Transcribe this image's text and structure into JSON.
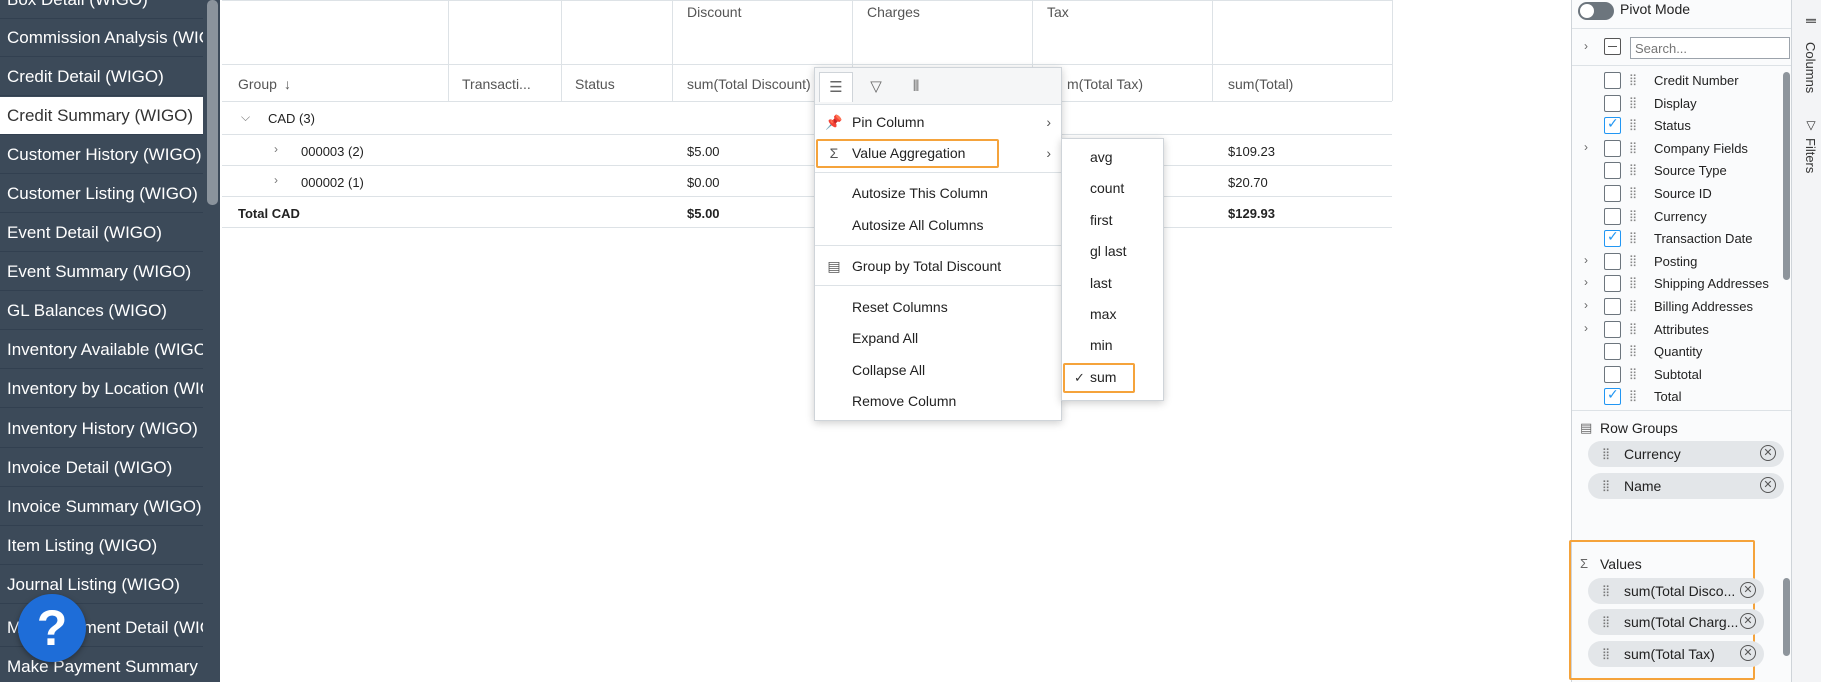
{
  "sidebar": {
    "items": [
      {
        "label": "Box Detail (WIGO)",
        "active": false
      },
      {
        "label": "Commission Analysis (WIGO)",
        "active": false
      },
      {
        "label": "Credit Detail (WIGO)",
        "active": false
      },
      {
        "label": "Credit Summary (WIGO)",
        "active": true
      },
      {
        "label": "Customer History (WIGO)",
        "active": false
      },
      {
        "label": "Customer Listing (WIGO)",
        "active": false
      },
      {
        "label": "Event Detail (WIGO)",
        "active": false
      },
      {
        "label": "Event Summary (WIGO)",
        "active": false
      },
      {
        "label": "GL Balances (WIGO)",
        "active": false
      },
      {
        "label": "Inventory Available (WIGO)",
        "active": false
      },
      {
        "label": "Inventory by Location (WIGO)",
        "active": false
      },
      {
        "label": "Inventory History (WIGO)",
        "active": false
      },
      {
        "label": "Invoice Detail (WIGO)",
        "active": false
      },
      {
        "label": "Invoice Summary (WIGO)",
        "active": false
      },
      {
        "label": "Item Listing (WIGO)",
        "active": false
      },
      {
        "label": "Journal Listing (WIGO)",
        "active": false
      },
      {
        "label": "Make Payment Detail (WIGO)",
        "active": false
      },
      {
        "label": "Make Payment Summary (WIGO)",
        "active": false
      }
    ],
    "help_glyph": "?"
  },
  "grid": {
    "group_headers": [
      "Discount",
      "Charges",
      "Tax"
    ],
    "columns": [
      "Group",
      "Transacti...",
      "Status",
      "sum(Total Discount)",
      "sum(Total Charges)",
      "sum(Total Tax)",
      "sum(Total)"
    ],
    "sort_glyph": "↓",
    "visible_header_fragment": "m(Total Tax)",
    "rows": [
      {
        "label": "CAD (3)",
        "discount": "",
        "total": ""
      },
      {
        "label": "000003 (2)",
        "discount": "$5.00",
        "total": "$109.23"
      },
      {
        "label": "000002 (1)",
        "discount": "$0.00",
        "total": "$20.70"
      },
      {
        "label": "Total CAD",
        "discount": "$5.00",
        "total": "$129.93"
      }
    ]
  },
  "column_menu": {
    "tabs": [
      "general-menu",
      "filter",
      "columns"
    ],
    "items": {
      "pin_column": "Pin Column",
      "value_aggregation": "Value Aggregation",
      "autosize_this": "Autosize This Column",
      "autosize_all": "Autosize All Columns",
      "group_by": "Group by Total Discount",
      "reset_columns": "Reset Columns",
      "expand_all": "Expand All",
      "collapse_all": "Collapse All",
      "remove_column": "Remove Column"
    }
  },
  "aggregation_menu": {
    "options": [
      "avg",
      "count",
      "first",
      "gl last",
      "last",
      "max",
      "min",
      "sum"
    ],
    "selected": "sum"
  },
  "tool_panel": {
    "pivot_mode_label": "Pivot Mode",
    "search_placeholder": "Search...",
    "columns": [
      {
        "label": "Credit Number",
        "checked": false,
        "expandable": false
      },
      {
        "label": "Display",
        "checked": false,
        "expandable": false
      },
      {
        "label": "Status",
        "checked": true,
        "expandable": false
      },
      {
        "label": "Company Fields",
        "checked": false,
        "expandable": true
      },
      {
        "label": "Source Type",
        "checked": false,
        "expandable": false
      },
      {
        "label": "Source ID",
        "checked": false,
        "expandable": false
      },
      {
        "label": "Currency",
        "checked": false,
        "expandable": false
      },
      {
        "label": "Transaction Date",
        "checked": true,
        "expandable": false
      },
      {
        "label": "Posting",
        "checked": false,
        "expandable": true
      },
      {
        "label": "Shipping Addresses",
        "checked": false,
        "expandable": true
      },
      {
        "label": "Billing Addresses",
        "checked": false,
        "expandable": true
      },
      {
        "label": "Attributes",
        "checked": false,
        "expandable": true
      },
      {
        "label": "Quantity",
        "checked": false,
        "expandable": false
      },
      {
        "label": "Subtotal",
        "checked": false,
        "expandable": false
      },
      {
        "label": "Total",
        "checked": true,
        "expandable": false
      }
    ],
    "row_groups_title": "Row Groups",
    "row_groups": [
      "Currency",
      "Name"
    ],
    "values_title": "Values",
    "values": [
      "sum(Total Disco...",
      "sum(Total Charg...",
      "sum(Total Tax)"
    ],
    "side_tabs": [
      "Columns",
      "Filters"
    ]
  },
  "colors": {
    "sidebar_bg": "#3c4a59",
    "highlight": "#f5a33b",
    "check_blue": "#2196f3",
    "help_blue": "#1e6dd8"
  }
}
